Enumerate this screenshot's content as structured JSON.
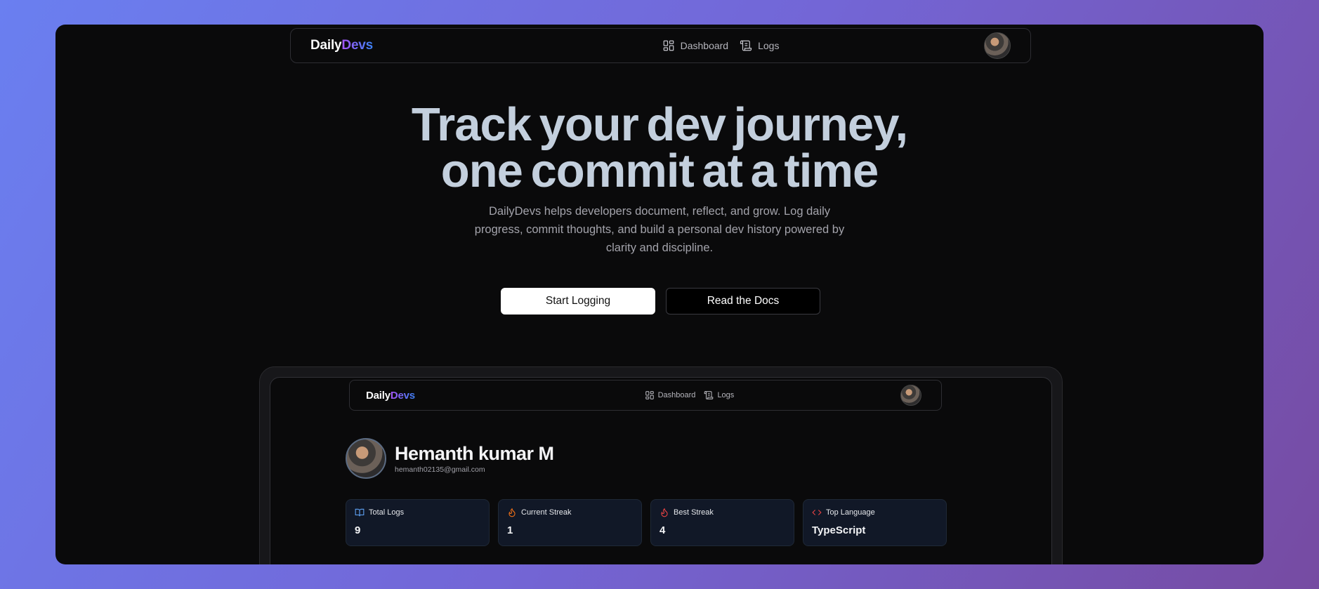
{
  "brand": {
    "prefix": "Daily",
    "accent": "Devs"
  },
  "nav": {
    "dashboard_label": "Dashboard",
    "logs_label": "Logs"
  },
  "hero": {
    "title_line1": "Track your dev journey,",
    "title_line2": "one commit at a time",
    "subtitle": "DailyDevs helps developers document, reflect, and grow. Log daily progress, commit thoughts, and build a personal dev history powered by clarity and discipline.",
    "primary_button": "Start Logging",
    "secondary_button": "Read the Docs"
  },
  "preview": {
    "profile": {
      "name": "Hemanth kumar M",
      "email": "hemanth02135@gmail.com"
    },
    "stats": [
      {
        "label": "Total Logs",
        "value": "9",
        "icon": "book-open-icon",
        "color": "#60a5fa"
      },
      {
        "label": "Current Streak",
        "value": "1",
        "icon": "flame-icon",
        "color": "#f97316"
      },
      {
        "label": "Best Streak",
        "value": "4",
        "icon": "flame-icon",
        "color": "#ef4444"
      },
      {
        "label": "Top Language",
        "value": "TypeScript",
        "icon": "code-icon",
        "color": "#ef4444"
      }
    ]
  },
  "colors": {
    "background_gradient_start": "#6a7ff0",
    "background_gradient_end": "#764ba2",
    "accent_purple": "#a855f7",
    "accent_blue": "#3b82f6"
  }
}
